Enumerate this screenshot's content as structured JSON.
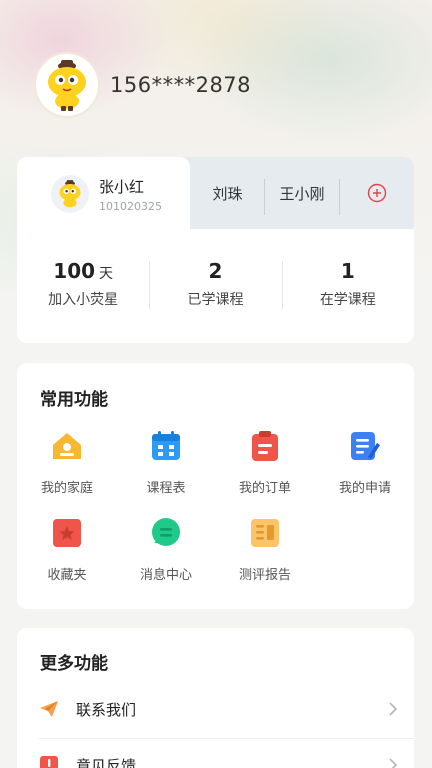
{
  "user": {
    "phone": "156****2878"
  },
  "children": {
    "active": {
      "name": "张小红",
      "id": "101020325"
    },
    "tabs": [
      "刘珠",
      "王小刚"
    ]
  },
  "stats": [
    {
      "value": "100",
      "unit": "天",
      "label": "加入小荧星"
    },
    {
      "value": "2",
      "unit": "",
      "label": "已学课程"
    },
    {
      "value": "1",
      "unit": "",
      "label": "在学课程"
    }
  ],
  "common_functions": {
    "title": "常用功能",
    "items": [
      {
        "label": "我的家庭",
        "icon": "home-icon",
        "color": "#f7b731"
      },
      {
        "label": "课程表",
        "icon": "calendar-icon",
        "color": "#2b9bf4"
      },
      {
        "label": "我的订单",
        "icon": "order-icon",
        "color": "#f0554a"
      },
      {
        "label": "我的申请",
        "icon": "application-icon",
        "color": "#3d7ff5"
      },
      {
        "label": "收藏夹",
        "icon": "favorites-icon",
        "color": "#f0554a"
      },
      {
        "label": "消息中心",
        "icon": "message-icon",
        "color": "#1fc98a"
      },
      {
        "label": "测评报告",
        "icon": "report-icon",
        "color": "#f7b731"
      }
    ]
  },
  "more_functions": {
    "title": "更多功能",
    "items": [
      {
        "label": "联系我们",
        "icon": "paper-plane-icon",
        "color": "#f5a04a"
      },
      {
        "label": "意见反馈",
        "icon": "feedback-icon",
        "color": "#f0554a"
      }
    ]
  }
}
